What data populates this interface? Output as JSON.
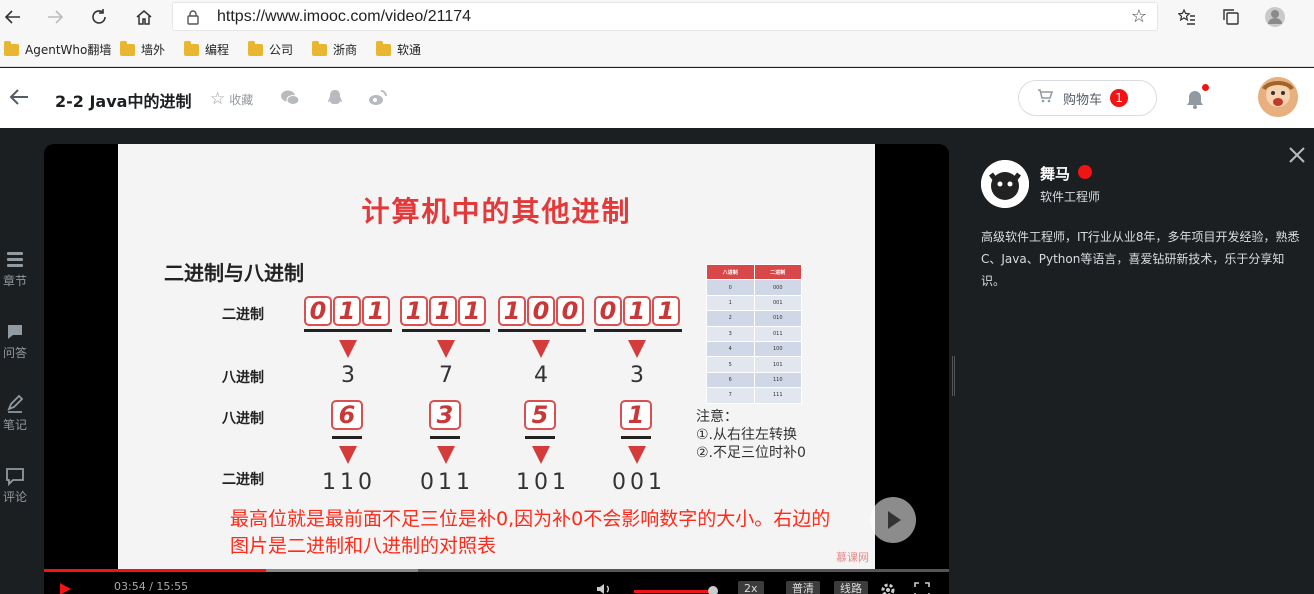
{
  "browser": {
    "url": "https://www.imooc.com/video/21174",
    "bookmarks": [
      "AgentWho翻墙",
      "墙外",
      "编程",
      "公司",
      "浙商",
      "软通"
    ]
  },
  "header": {
    "course_title": "2-2 Java中的进制",
    "favorite_label": "收藏",
    "cart_label": "购物车",
    "cart_count": "1"
  },
  "rail": [
    "章节",
    "问答",
    "笔记",
    "评论"
  ],
  "slide": {
    "title": "计算机中的其他进制",
    "subtitle": "二进制与八进制",
    "label_binary": "二进制",
    "label_octal": "八进制",
    "label_octal2": "八进制",
    "label_binary2": "二进制",
    "bits": [
      "0",
      "1",
      "1",
      "1",
      "1",
      "1",
      "1",
      "0",
      "0",
      "0",
      "1",
      "1"
    ],
    "octal_values": [
      "3",
      "7",
      "4",
      "3"
    ],
    "octal_boxes": [
      "6",
      "3",
      "5",
      "1"
    ],
    "binary_groups": [
      "110",
      "011",
      "101",
      "001"
    ],
    "table_headers": [
      "八进制",
      "二进制"
    ],
    "table_rows": [
      [
        "0",
        "000"
      ],
      [
        "1",
        "001"
      ],
      [
        "2",
        "010"
      ],
      [
        "3",
        "011"
      ],
      [
        "4",
        "100"
      ],
      [
        "5",
        "101"
      ],
      [
        "6",
        "110"
      ],
      [
        "7",
        "111"
      ]
    ],
    "note_title": "注意：",
    "note_1": "①.从右往左转换",
    "note_2": "②.不足三位时补0",
    "watermark": "慕课网"
  },
  "video": {
    "subtitle_line1": "最高位就是最前面不足三位是补0,因为补0不会影响数字的大小。右边的",
    "subtitle_line2": "图片是二进制和八进制的对照表",
    "time": "03:54 / 15:55",
    "played_fraction": 0.245,
    "speed_label": "2x",
    "quality_label": "普清",
    "route_label": "线路"
  },
  "teacher": {
    "name": "舞马",
    "role": "软件工程师",
    "bio": "高级软件工程师，IT行业从业8年，多年项目开发经验，熟悉C、Java、Python等语言，喜爱钻研新技术，乐于分享知识。"
  },
  "colors": {
    "accent": "#f01414",
    "slide_red": "#e23a3a"
  }
}
